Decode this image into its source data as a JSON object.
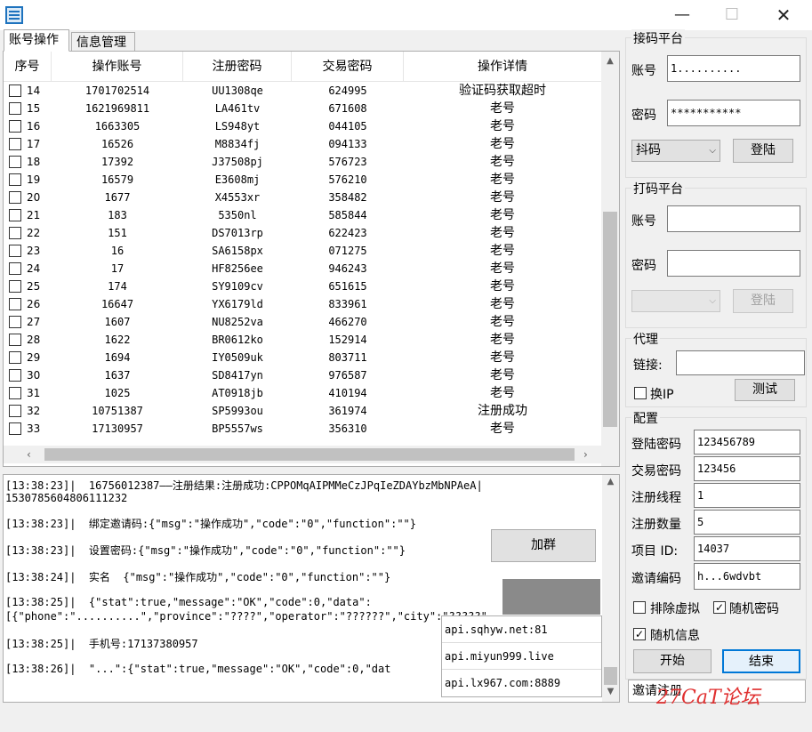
{
  "window": {
    "minimize": "—",
    "maximize": "☐",
    "close": "✕"
  },
  "tabs": [
    "账号操作",
    "信息管理"
  ],
  "grid": {
    "headers": [
      "序号",
      "操作账号",
      "注册密码",
      "交易密码",
      "操作详情"
    ],
    "rows": [
      {
        "no": "14",
        "account": "1701702514",
        "reg_pwd": "UU1308qe",
        "trade_pwd": "624995",
        "detail": "验证码获取超时"
      },
      {
        "no": "15",
        "account": "1621969811",
        "reg_pwd": "LA461tv",
        "trade_pwd": "671608",
        "detail": "老号"
      },
      {
        "no": "16",
        "account": "1663305",
        "reg_pwd": "LS948yt",
        "trade_pwd": "044105",
        "detail": "老号"
      },
      {
        "no": "17",
        "account": "16526",
        "reg_pwd": "M8834fj",
        "trade_pwd": "094133",
        "detail": "老号"
      },
      {
        "no": "18",
        "account": "17392",
        "reg_pwd": "J37508pj",
        "trade_pwd": "576723",
        "detail": "老号"
      },
      {
        "no": "19",
        "account": "16579",
        "reg_pwd": "E3608mj",
        "trade_pwd": "576210",
        "detail": "老号"
      },
      {
        "no": "20",
        "account": "1677",
        "reg_pwd": "X4553xr",
        "trade_pwd": "358482",
        "detail": "老号"
      },
      {
        "no": "21",
        "account": "183",
        "reg_pwd": "5350nl",
        "trade_pwd": "585844",
        "detail": "老号"
      },
      {
        "no": "22",
        "account": "151",
        "reg_pwd": "DS7013rp",
        "trade_pwd": "622423",
        "detail": "老号"
      },
      {
        "no": "23",
        "account": "16",
        "reg_pwd": "SA6158px",
        "trade_pwd": "071275",
        "detail": "老号"
      },
      {
        "no": "24",
        "account": "17",
        "reg_pwd": "HF8256ee",
        "trade_pwd": "946243",
        "detail": "老号"
      },
      {
        "no": "25",
        "account": "174",
        "reg_pwd": "SY9109cv",
        "trade_pwd": "651615",
        "detail": "老号"
      },
      {
        "no": "26",
        "account": "16647",
        "reg_pwd": "YX6179ld",
        "trade_pwd": "833961",
        "detail": "老号"
      },
      {
        "no": "27",
        "account": "1607",
        "reg_pwd": "NU8252va",
        "trade_pwd": "466270",
        "detail": "老号"
      },
      {
        "no": "28",
        "account": "1622",
        "reg_pwd": "BR0612ko",
        "trade_pwd": "152914",
        "detail": "老号"
      },
      {
        "no": "29",
        "account": "1694",
        "reg_pwd": "IY0509uk",
        "trade_pwd": "803711",
        "detail": "老号"
      },
      {
        "no": "30",
        "account": "1637",
        "reg_pwd": "SD8417yn",
        "trade_pwd": "976587",
        "detail": "老号"
      },
      {
        "no": "31",
        "account": "1025",
        "reg_pwd": "AT0918jb",
        "trade_pwd": "410194",
        "detail": "老号"
      },
      {
        "no": "32",
        "account": "10751387",
        "reg_pwd": "SP5993ou",
        "trade_pwd": "361974",
        "detail": "注册成功"
      },
      {
        "no": "33",
        "account": "17130957",
        "reg_pwd": "BP5557ws",
        "trade_pwd": "356310",
        "detail": "老号"
      }
    ]
  },
  "log": [
    "[13:38:23]|  16756012387——注册结果:注册成功:CPPOMqAIPMMeCzJPqIeZDAYbzMbNPAeA|",
    "1530785604806111232",
    "[13:38:23]|  绑定邀请码:{\"msg\":\"操作成功\",\"code\":\"0\",\"function\":\"\"}",
    "[13:38:23]|  设置密码:{\"msg\":\"操作成功\",\"code\":\"0\",\"function\":\"\"}",
    "[13:38:24]|  实名  {\"msg\":\"操作成功\",\"code\":\"0\",\"function\":\"\"}",
    "[13:38:25]|  {\"stat\":true,\"message\":\"OK\",\"code\":0,\"data\":",
    "[{\"phone\":\"..........\",\"province\":\"????\",\"operator\":\"??????\",\"city\":\"?????\"",
    "[13:38:25]|  手机号:17137380957",
    "[13:38:26]|  \"...\":{\"stat\":true,\"message\":\"OK\",\"code\":0,\"dat"
  ],
  "join_button": "加群",
  "api_list": [
    "api.sqhyw.net:81",
    "api.miyun999.live",
    "api.lx967.com:8889"
  ],
  "receive_platform": {
    "title": "接码平台",
    "account_label": "账号",
    "account_value": "1..........",
    "password_label": "密码",
    "password_value": "***********",
    "platform_select": "抖码",
    "login_button": "登陆"
  },
  "captcha_platform": {
    "title": "打码平台",
    "account_label": "账号",
    "account_value": "",
    "password_label": "密码",
    "password_value": "",
    "platform_select": "",
    "login_button": "登陆"
  },
  "proxy": {
    "title": "代理",
    "link_label": "链接:",
    "link_value": "",
    "switch_ip_label": "换IP",
    "test_button": "测试"
  },
  "config": {
    "title": "配置",
    "fields": [
      {
        "label": "登陆密码",
        "value": "123456789"
      },
      {
        "label": "交易密码",
        "value": "123456"
      },
      {
        "label": "注册线程",
        "value": "1"
      },
      {
        "label": "注册数量",
        "value": "5"
      },
      {
        "label": "项目 ID:",
        "value": "14037"
      },
      {
        "label": "邀请编码",
        "value": "h...6wdvbt"
      }
    ],
    "exclude_virtual": "排除虚拟",
    "random_password": "随机密码",
    "random_info": "随机信息",
    "exclude_virtual_checked": false,
    "random_password_checked": true,
    "random_info_checked": true,
    "start_button": "开始",
    "stop_button": "结束",
    "invite_select": "邀请注册"
  },
  "watermark": "27CaT论坛"
}
